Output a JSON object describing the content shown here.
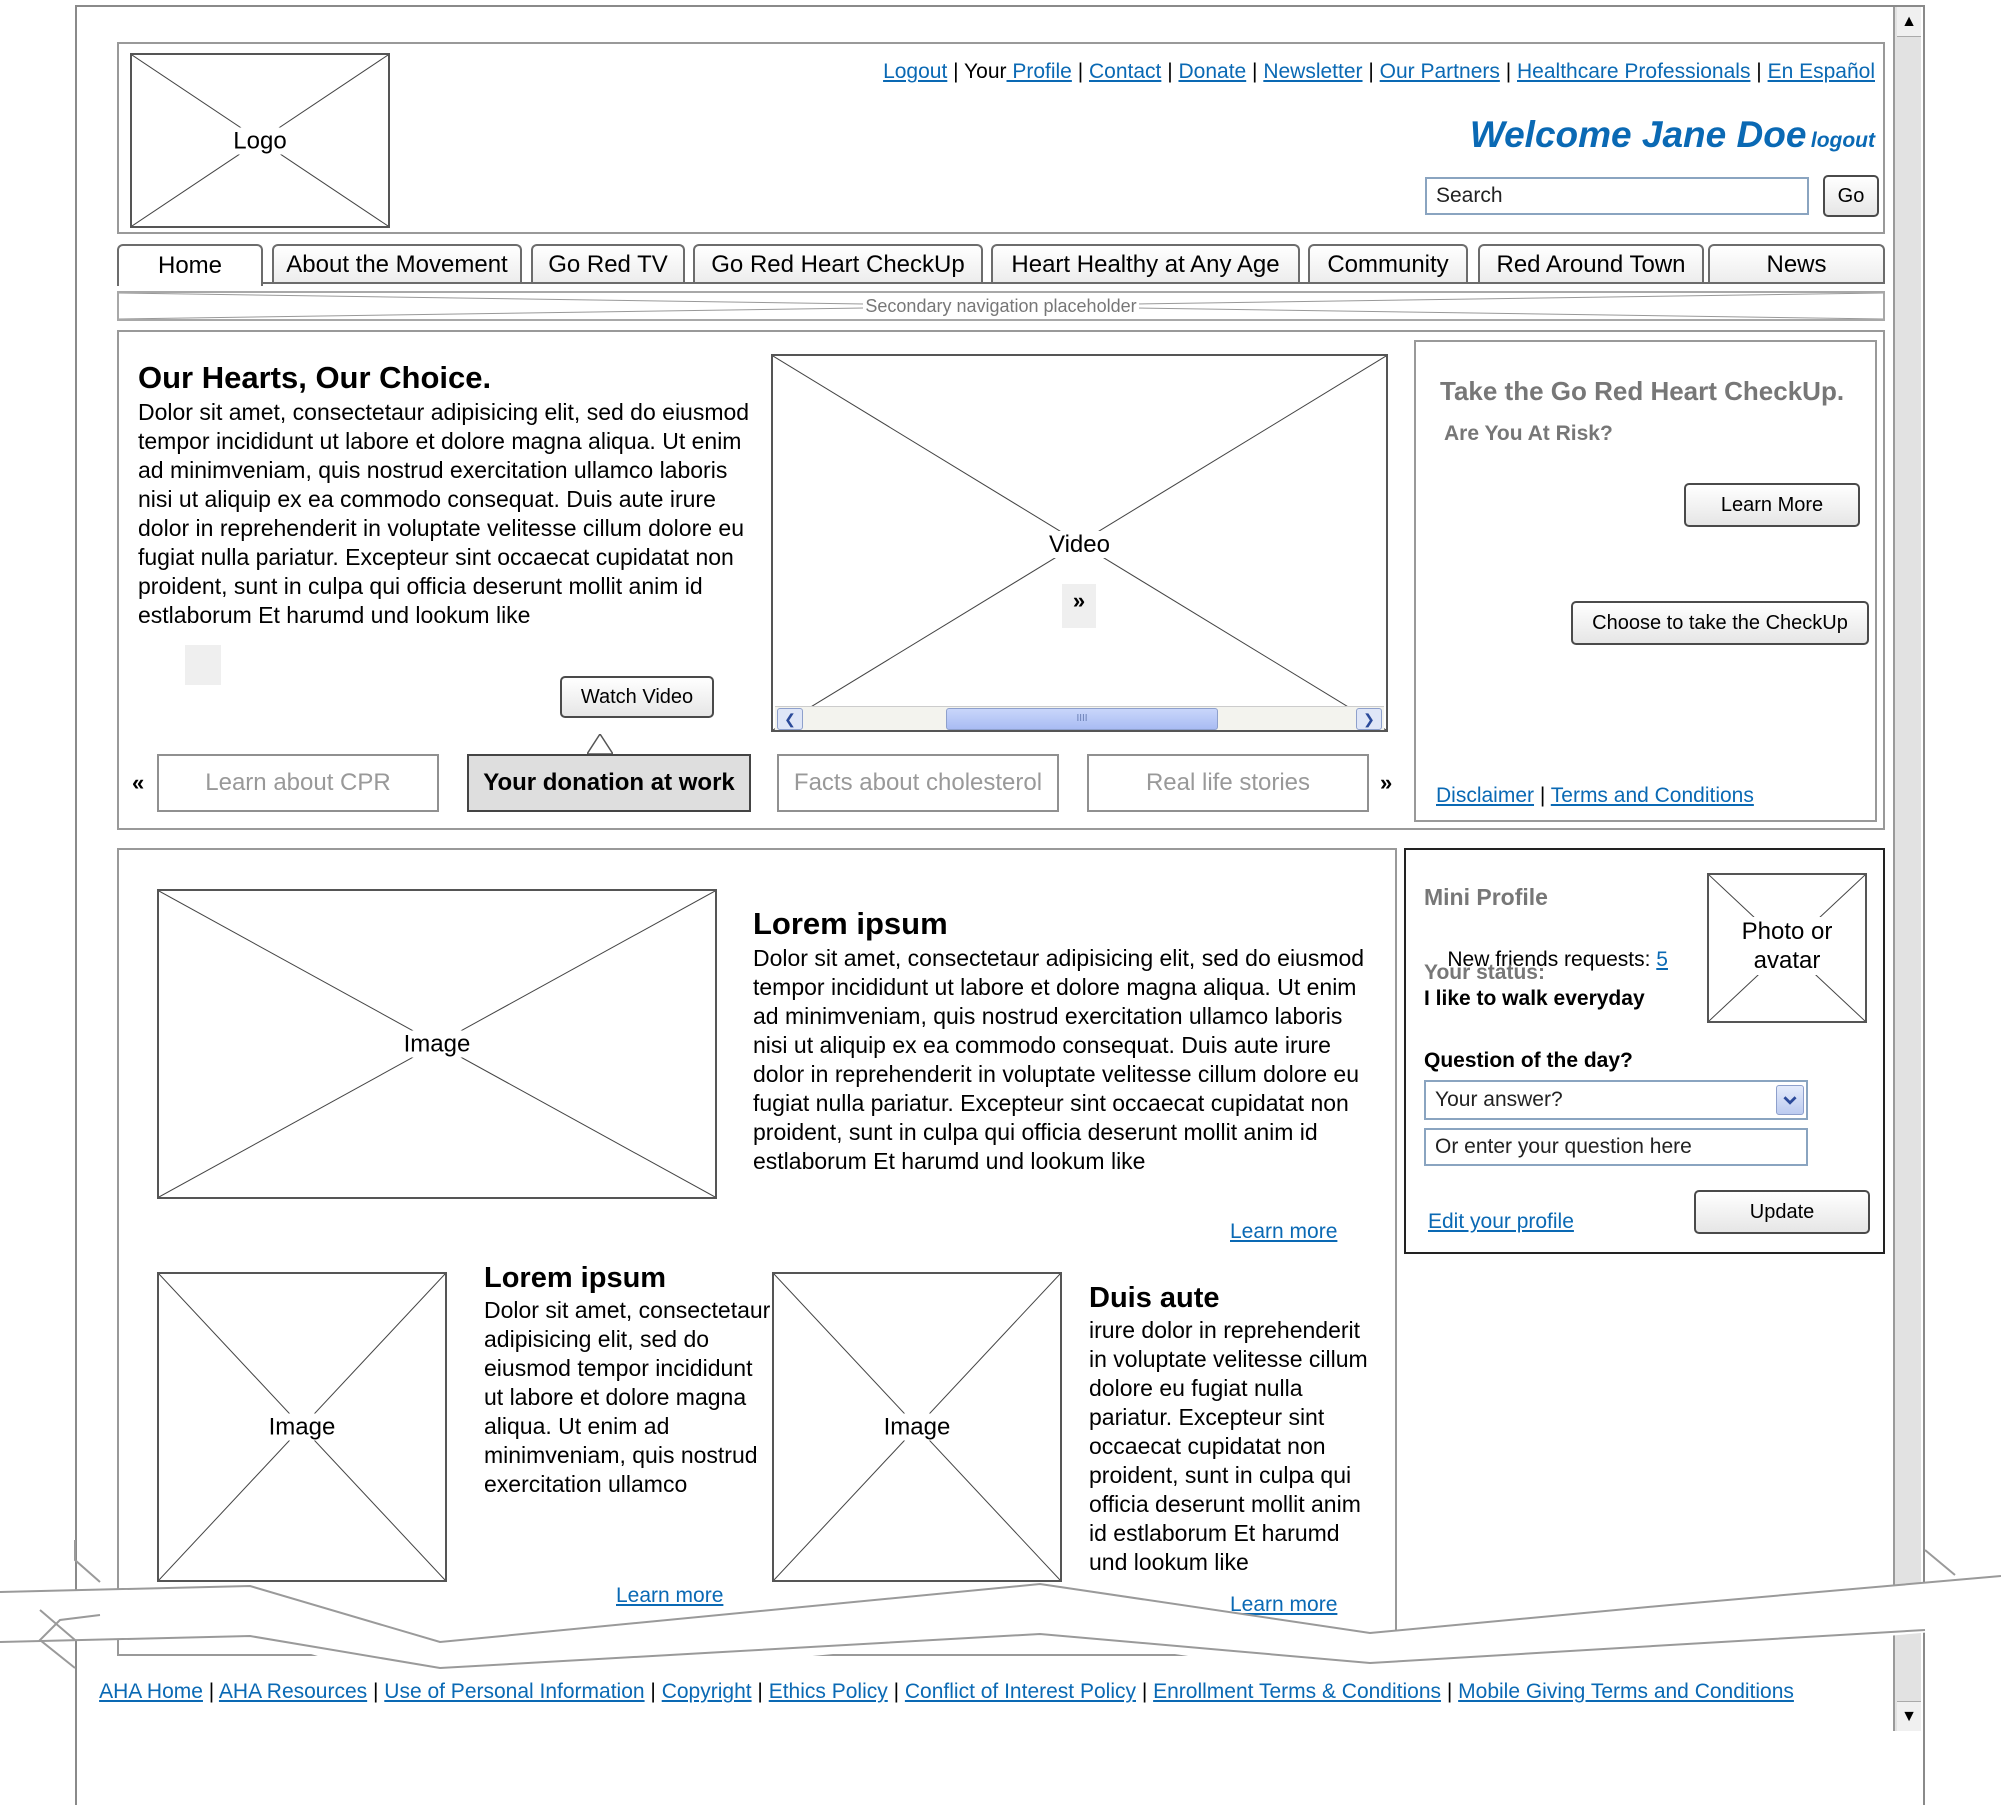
{
  "header": {
    "logo_label": "Logo",
    "utility_links": [
      {
        "text": "Logout",
        "link": true
      },
      {
        "text": " | Your",
        "link": false
      },
      {
        "text": " Profile",
        "link": true
      },
      {
        "text": " | ",
        "link": false
      },
      {
        "text": "Contact",
        "link": true
      },
      {
        "text": " | ",
        "link": false
      },
      {
        "text": "Donate",
        "link": true
      },
      {
        "text": " | ",
        "link": false
      },
      {
        "text": "Newsletter",
        "link": true
      },
      {
        "text": " | ",
        "link": false
      },
      {
        "text": "Our Partners",
        "link": true
      },
      {
        "text": " | ",
        "link": false
      },
      {
        "text": "Healthcare Professionals",
        "link": true
      },
      {
        "text": " | ",
        "link": false
      },
      {
        "text": "En Español",
        "link": true
      }
    ],
    "welcome": "Welcome Jane Doe",
    "logout": "logout",
    "search_value": "Search",
    "go_label": "Go"
  },
  "nav": {
    "tabs": [
      "Home",
      "About the Movement",
      "Go Red TV",
      "Go Red Heart CheckUp",
      "Heart Healthy at Any Age",
      "Community",
      "Red Around Town",
      "News"
    ],
    "secondary_placeholder": "Secondary navigation placeholder"
  },
  "hero": {
    "title": "Our Hearts, Our Choice.",
    "body": "Dolor sit amet, consectetaur adipisicing elit, sed do eiusmod tempor incididunt ut labore et dolore magna aliqua. Ut enim ad minimveniam, quis nostrud exercitation ullamco laboris nisi ut aliquip ex ea commodo consequat. Duis aute irure dolor in reprehenderit in voluptate velitesse cillum dolore eu fugiat nulla pariatur. Excepteur sint occaecat cupidatat non proident, sunt in culpa qui officia deserunt mollit anim id estlaborum Et harumd und lookum like",
    "watch_video": "Watch Video",
    "video_label": "Video",
    "video_next": "»",
    "scroll_grip": "IIII",
    "carousel_prev": "«",
    "carousel_next": "»",
    "carousel_items": [
      "Learn about CPR",
      "Your donation at work",
      "Facts about cholesterol",
      "Real life stories"
    ],
    "carousel_selected": 1
  },
  "checkup": {
    "title": "Take the Go Red Heart CheckUp.",
    "subtitle": "Are You At Risk?",
    "learn_more": "Learn More",
    "choose": "Choose to take the CheckUp",
    "disclaimer": "Disclaimer",
    "separator": " | ",
    "terms": "Terms and Conditions"
  },
  "content": {
    "feature": {
      "image_label": "Image",
      "title": "Lorem ipsum",
      "body": "Dolor sit amet, consectetaur adipisicing elit, sed do eiusmod tempor incididunt ut labore et dolore magna aliqua. Ut enim ad minimveniam, quis nostrud exercitation ullamco laboris nisi ut aliquip ex ea commodo consequat. Duis aute irure dolor in reprehenderit in voluptate velitesse cillum dolore eu fugiat nulla pariatur. Excepteur sint occaecat cupidatat non proident, sunt in culpa qui officia deserunt mollit anim id estlaborum Et harumd und lookum like",
      "learn_more": "Learn more"
    },
    "card1": {
      "image_label": "Image",
      "title": "Lorem ipsum",
      "body": "Dolor sit amet, consectetaur adipisicing elit, sed do eiusmod tempor incididunt ut labore et dolore magna aliqua. Ut enim ad minimveniam, quis nostrud exercitation ullamco",
      "learn_more": "Learn more"
    },
    "card2": {
      "image_label": "Image",
      "title": "Duis aute",
      "body": "irure dolor in reprehenderit in voluptate velitesse cillum dolore eu fugiat nulla pariatur. Excepteur sint occaecat cupidatat non proident, sunt in culpa qui officia deserunt mollit anim id estlaborum Et harumd und lookum like",
      "learn_more": "Learn more"
    }
  },
  "profile": {
    "title": "Mini Profile",
    "friends_label": "New friends requests: ",
    "friends_count": "5",
    "status_label": "Your status:",
    "status_value": "I like to walk everyday",
    "photo_label": "Photo or avatar",
    "question_label": "Question of the day?",
    "answer_placeholder": "Your answer?",
    "question_placeholder": "Or enter your question here",
    "edit_profile": "Edit your profile",
    "update": "Update"
  },
  "footer": {
    "links": [
      {
        "text": "AHA Home",
        "link": true
      },
      {
        "text": " | ",
        "link": false
      },
      {
        "text": "AHA Resources",
        "link": true
      },
      {
        "text": " | ",
        "link": false
      },
      {
        "text": "Use of Personal Information",
        "link": true
      },
      {
        "text": " | ",
        "link": false
      },
      {
        "text": "Copyright",
        "link": true
      },
      {
        "text": " | ",
        "link": false
      },
      {
        "text": "Ethics Policy",
        "link": true
      },
      {
        "text": " | ",
        "link": false
      },
      {
        "text": "Conflict of Interest Policy",
        "link": true
      },
      {
        "text": " | ",
        "link": false
      },
      {
        "text": "Enrollment Terms & Conditions",
        "link": true
      },
      {
        "text": " | ",
        "link": false
      },
      {
        "text": "Mobile Giving Terms and Conditions",
        "link": true
      }
    ]
  },
  "scrollbar": {
    "up_icon": "▲",
    "down_icon": "▼"
  },
  "colors": {
    "link": "#0a69b4",
    "welcome": "#0a69b4",
    "muted_heading": "#777777",
    "input_border": "#8aa4c0"
  }
}
